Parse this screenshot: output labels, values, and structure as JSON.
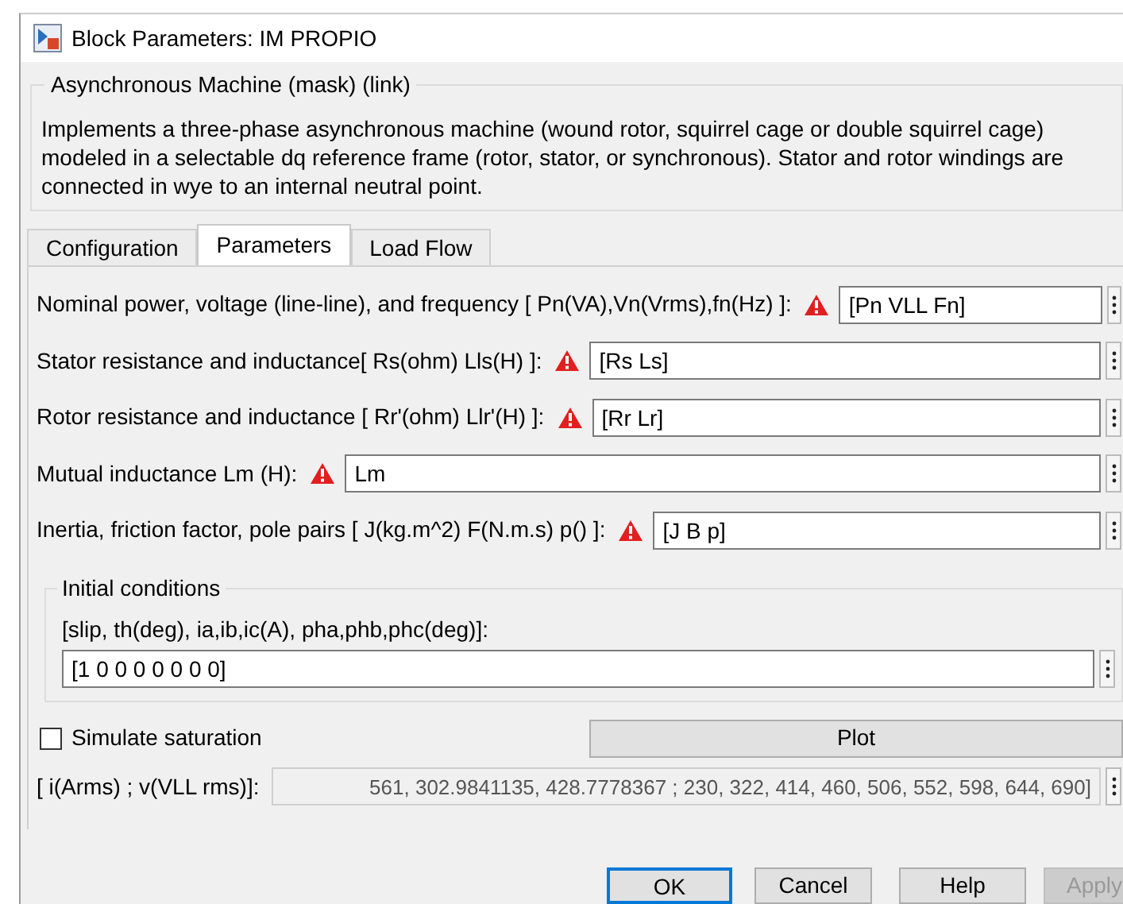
{
  "window": {
    "title": "Block Parameters: IM PROPIO"
  },
  "mask": {
    "title": "Asynchronous Machine (mask) (link)",
    "description": "Implements a three-phase asynchronous machine (wound rotor, squirrel cage or double squirrel cage) modeled in a selectable dq reference frame (rotor, stator, or synchronous). Stator and rotor windings are connected in wye to an internal neutral point."
  },
  "tabs": [
    {
      "label": "Configuration",
      "selected": false
    },
    {
      "label": "Parameters",
      "selected": true
    },
    {
      "label": "Load Flow",
      "selected": false
    }
  ],
  "parameters": [
    {
      "label": "Nominal power, voltage (line-line), and frequency [ Pn(VA),Vn(Vrms),fn(Hz) ]:",
      "warning": true,
      "value": "[Pn VLL Fn]"
    },
    {
      "label": "Stator resistance and inductance[ Rs(ohm)  Lls(H) ]:",
      "warning": true,
      "value": "[Rs Ls]"
    },
    {
      "label": "Rotor resistance and inductance [ Rr'(ohm)  Llr'(H) ]:",
      "warning": true,
      "value": "[Rr Lr]"
    },
    {
      "label": "Mutual inductance Lm (H):",
      "warning": true,
      "value": "Lm"
    },
    {
      "label": "Inertia, friction factor, pole pairs [ J(kg.m^2)  F(N.m.s)   p() ]:",
      "warning": true,
      "value": "[J B p]"
    }
  ],
  "initial_conditions": {
    "title": "Initial conditions",
    "label": "[slip, th(deg), ia,ib,ic(A), pha,phb,phc(deg)]:",
    "value": "[1 0 0 0 0 0 0 0]"
  },
  "simulate_saturation": {
    "label": "Simulate saturation",
    "checked": false
  },
  "plot_button": {
    "label": "Plot"
  },
  "saturation_data": {
    "label": "[ i(Arms) ; v(VLL rms)]:",
    "value": "561, 302.9841135, 428.7778367 ; 230, 322, 414, 460, 506, 552, 598, 644, 690]",
    "disabled": true
  },
  "buttons": [
    {
      "label": "OK",
      "default": true,
      "disabled": false
    },
    {
      "label": "Cancel",
      "default": false,
      "disabled": false
    },
    {
      "label": "Help",
      "default": false,
      "disabled": false
    },
    {
      "label": "Apply",
      "default": false,
      "disabled": true
    }
  ]
}
